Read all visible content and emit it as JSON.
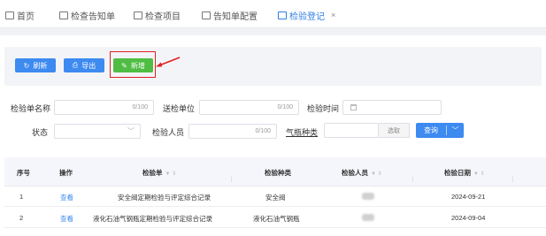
{
  "tabs": [
    {
      "label": "首页",
      "active": false
    },
    {
      "label": "检查告知单",
      "active": false
    },
    {
      "label": "检查项目",
      "active": false
    },
    {
      "label": "告知单配置",
      "active": false
    },
    {
      "label": "检验登记",
      "active": true,
      "close": "×"
    }
  ],
  "toolbar": {
    "refresh_icon": "refresh-icon",
    "refresh_label": "刷新",
    "export_icon": "export-icon",
    "export_label": "导出",
    "add_icon": "edit-icon",
    "add_label": "新增"
  },
  "filters": {
    "report_name_label": "检验单名称",
    "report_name_count": "0/100",
    "unit_label": "送检单位",
    "unit_count": "0/100",
    "time_label": "检验时间",
    "status_label": "状态",
    "inspector_label": "检验人员",
    "inspector_count": "0/100",
    "cylinder_label": "气瓶种类",
    "pick_label": "选取",
    "query_label": "查询"
  },
  "table": {
    "headers": [
      "序号",
      "操作",
      "检验单",
      "检验种类",
      "检验人员",
      "检验日期"
    ],
    "rows": [
      {
        "index": "1",
        "action": "查看",
        "report": "安全阀定期检验与评定综合记录",
        "type": "安全阀",
        "date": "2024-09-21"
      },
      {
        "index": "2",
        "action": "查看",
        "report": "液化石油气钢瓶定期检验与评定综合记录",
        "type": "液化石油气钢瓶",
        "date": "2024-09-04"
      }
    ]
  },
  "colors": {
    "primary": "#3d8af0",
    "success": "#4fbd43",
    "highlight": "#e02020"
  }
}
